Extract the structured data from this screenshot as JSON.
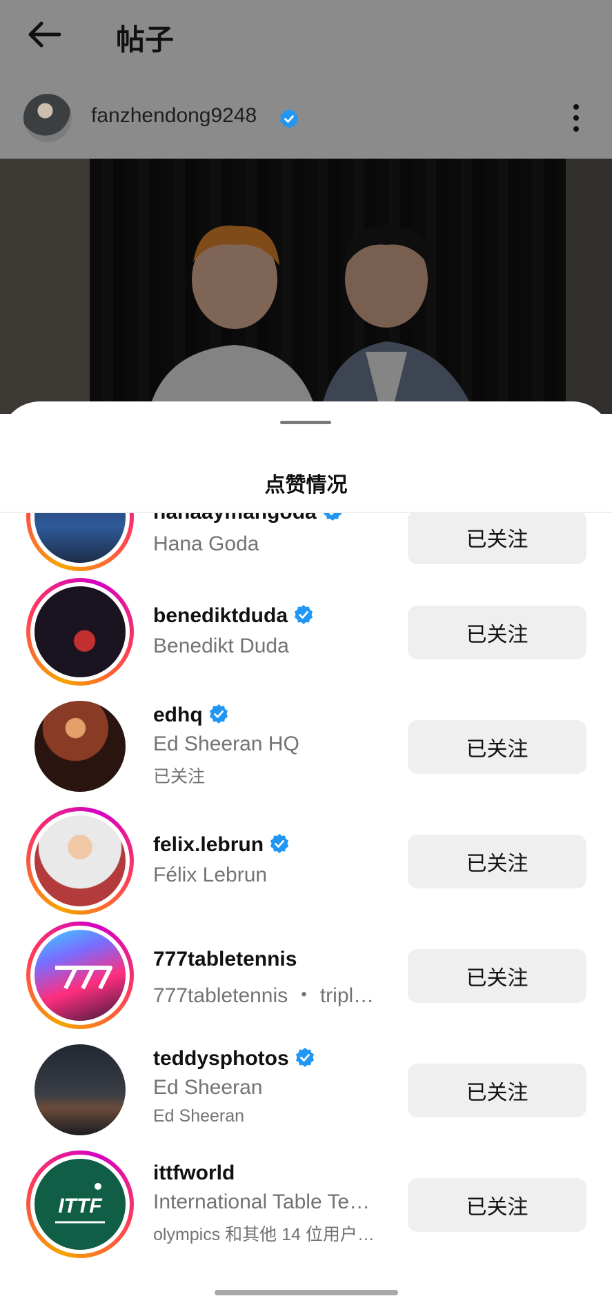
{
  "header": {
    "title": "帖子"
  },
  "post": {
    "author": "fanzhendong9248"
  },
  "sheet": {
    "title": "点赞情况"
  },
  "likes": [
    {
      "username": "hanaaymangoda",
      "fullname": "Hana Goda",
      "extra": "",
      "verified": true,
      "story": true,
      "button": "已关注"
    },
    {
      "username": "benediktduda",
      "fullname": "Benedikt Duda",
      "extra": "",
      "verified": true,
      "story": true,
      "button": "已关注"
    },
    {
      "username": "edhq",
      "fullname": "Ed Sheeran HQ",
      "extra": "已关注",
      "verified": true,
      "story": false,
      "button": "已关注"
    },
    {
      "username": "felix.lebrun",
      "fullname": "Félix Lebrun",
      "extra": "",
      "verified": true,
      "story": true,
      "button": "已关注"
    },
    {
      "username": "777tabletennis",
      "fullname": "777tabletennis ・ tripl…",
      "extra": "",
      "verified": false,
      "story": true,
      "button": "已关注"
    },
    {
      "username": "teddysphotos",
      "fullname": "Ed Sheeran",
      "extra": "Ed Sheeran",
      "verified": true,
      "story": false,
      "button": "已关注"
    },
    {
      "username": "ittfworld",
      "fullname": "International Table Te…",
      "extra": "olympics 和其他 14 位用户…",
      "verified": false,
      "story": true,
      "button": "已关注"
    }
  ],
  "colors": {
    "verified": "#2196f3",
    "button_bg": "#efefef",
    "secondary_text": "#737373"
  },
  "icons": [
    "back-arrow-icon",
    "verified-icon",
    "more-vertical-icon"
  ]
}
